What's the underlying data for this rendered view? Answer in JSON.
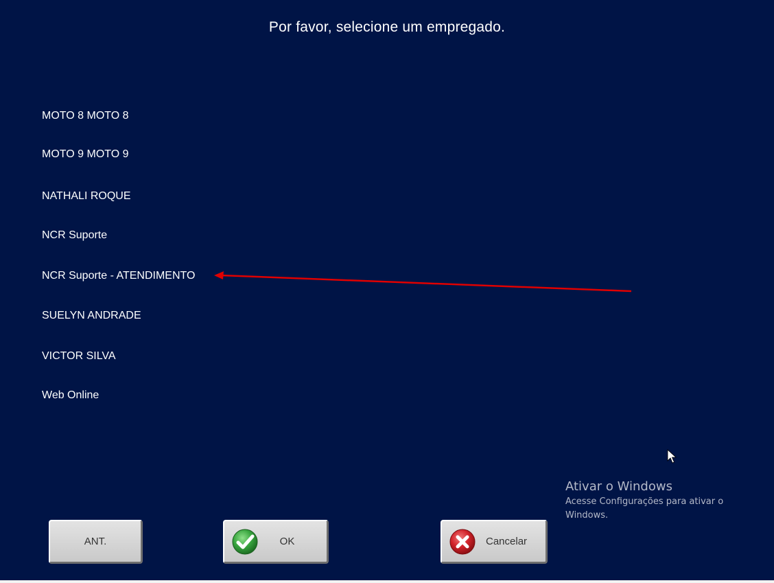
{
  "prompt": "Por favor, selecione um empregado.",
  "employees": [
    "MOTO 8 MOTO 8",
    "MOTO 9 MOTO 9",
    "NATHALI ROQUE",
    "NCR Suporte",
    "NCR Suporte - ATENDIMENTO",
    "SUELYN ANDRADE",
    "VICTOR SILVA",
    "Web Online"
  ],
  "buttons": {
    "prev": "ANT.",
    "ok": "OK",
    "cancel": "Cancelar"
  },
  "windows_activation": {
    "title": "Ativar o Windows",
    "message": "Acesse Configurações para ativar o Windows."
  },
  "icons": {
    "ok": "check-icon",
    "cancel": "close-icon",
    "pointer": "mouse-pointer-icon",
    "annotation": "red-arrow-annotation"
  },
  "colors": {
    "background": "#001446",
    "text": "#ffffff",
    "button_face": "#d6d6d6",
    "ok_icon": "#3aa640",
    "cancel_icon": "#d2232a",
    "annotation": "#e00000"
  }
}
